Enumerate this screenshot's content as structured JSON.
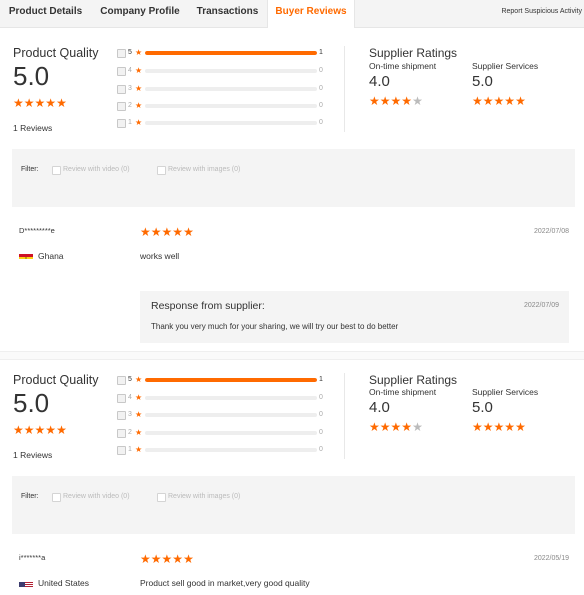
{
  "tabs": [
    {
      "label": "Product Details",
      "active": false
    },
    {
      "label": "Company Profile",
      "active": false
    },
    {
      "label": "Transactions",
      "active": false
    },
    {
      "label": "Buyer Reviews",
      "active": true
    }
  ],
  "report_link": "Report Suspicious Activity",
  "accent_color": "#ff6a00",
  "sections": [
    {
      "product_quality": {
        "title": "Product Quality",
        "score": "5.0",
        "stars": 5,
        "reviews_count": "1 Reviews",
        "distribution": [
          {
            "star": "5",
            "count": "1",
            "fraction": 1.0
          },
          {
            "star": "4",
            "count": "0",
            "fraction": 0
          },
          {
            "star": "3",
            "count": "0",
            "fraction": 0
          },
          {
            "star": "2",
            "count": "0",
            "fraction": 0
          },
          {
            "star": "1",
            "count": "0",
            "fraction": 0
          }
        ]
      },
      "supplier_ratings": {
        "title": "Supplier Ratings",
        "on_time_label": "On-time shipment",
        "on_time_score": "4.0",
        "on_time_stars": 4,
        "services_label": "Supplier Services",
        "services_score": "5.0",
        "services_stars": 5
      },
      "filter": {
        "label": "Filter:",
        "video_option": "Review with video (0)",
        "images_option": "Review with images (0)"
      },
      "review": {
        "reviewer": "D*********e",
        "country": "Ghana",
        "flag": "ghana-flag",
        "stars": 5,
        "date": "2022/07/08",
        "text": "works well"
      },
      "response": {
        "title": "Response from supplier:",
        "date": "2022/07/09",
        "text": "Thank you very much for your sharing, we will try our best to do better"
      }
    },
    {
      "product_quality": {
        "title": "Product Quality",
        "score": "5.0",
        "stars": 5,
        "reviews_count": "1 Reviews",
        "distribution": [
          {
            "star": "5",
            "count": "1",
            "fraction": 1.0
          },
          {
            "star": "4",
            "count": "0",
            "fraction": 0
          },
          {
            "star": "3",
            "count": "0",
            "fraction": 0
          },
          {
            "star": "2",
            "count": "0",
            "fraction": 0
          },
          {
            "star": "1",
            "count": "0",
            "fraction": 0
          }
        ]
      },
      "supplier_ratings": {
        "title": "Supplier Ratings",
        "on_time_label": "On-time shipment",
        "on_time_score": "4.0",
        "on_time_stars": 4,
        "services_label": "Supplier Services",
        "services_score": "5.0",
        "services_stars": 5
      },
      "filter": {
        "label": "Filter:",
        "video_option": "Review with video (0)",
        "images_option": "Review with images (0)"
      },
      "review": {
        "reviewer": "i*******a",
        "country": "United States",
        "flag": "us-flag",
        "stars": 5,
        "date": "2022/05/19",
        "text": "Product sell good in market,very good quality"
      }
    }
  ]
}
